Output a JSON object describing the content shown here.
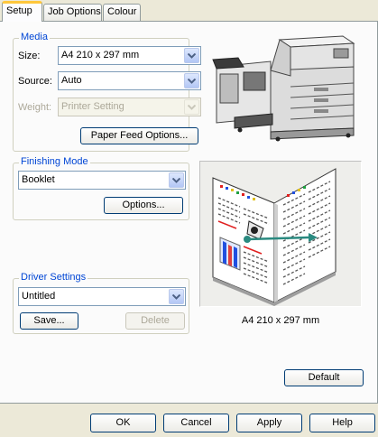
{
  "tabs": [
    {
      "label": "Setup",
      "active": true
    },
    {
      "label": "Job Options",
      "active": false
    },
    {
      "label": "Colour",
      "active": false
    }
  ],
  "media": {
    "legend": "Media",
    "size_label": "Size:",
    "size_value": "A4 210 x 297 mm",
    "source_label": "Source:",
    "source_value": "Auto",
    "weight_label": "Weight:",
    "weight_value": "Printer Setting",
    "paper_feed_button": "Paper Feed Options..."
  },
  "finishing": {
    "legend": "Finishing Mode",
    "mode_value": "Booklet",
    "options_button": "Options..."
  },
  "driver": {
    "legend": "Driver Settings",
    "value": "Untitled",
    "save_button": "Save...",
    "delete_button": "Delete"
  },
  "preview": {
    "caption": "A4 210 x 297 mm"
  },
  "default_button": "Default",
  "footer": {
    "ok": "OK",
    "cancel": "Cancel",
    "apply": "Apply",
    "help": "Help"
  },
  "colors": {
    "accent_tab": "#ffc73c",
    "legend_blue": "#0046d5",
    "button_border": "#003c74"
  }
}
